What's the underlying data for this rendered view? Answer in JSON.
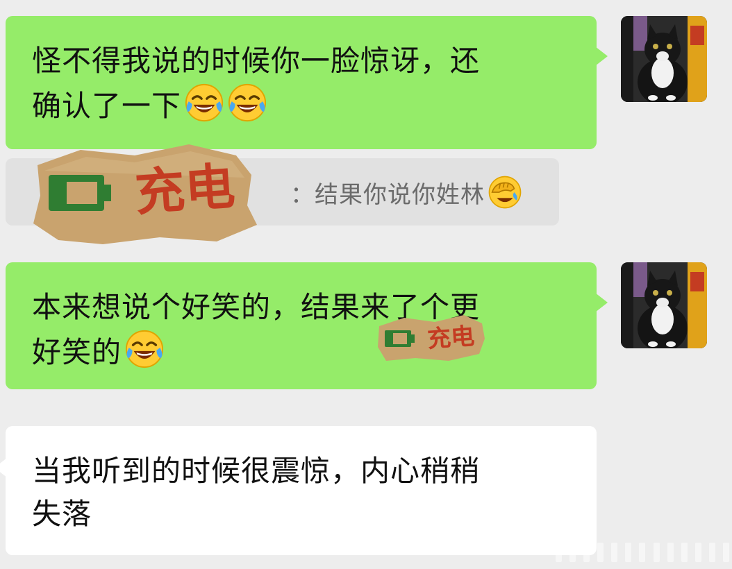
{
  "messages": [
    {
      "direction": "outgoing",
      "text_line1": "怪不得我说的时候你一脸惊讶，还",
      "text_line2": "确认了一下",
      "emojis": [
        "tears-of-joy-emoji",
        "tears-of-joy-emoji"
      ]
    },
    {
      "direction": "outgoing-quote",
      "quote_text": "：结果你说你姓林",
      "emoji": "facepalm-emoji"
    },
    {
      "direction": "outgoing",
      "text_line1": "本来想说个好笑的，结果来了个更",
      "text_line2": "好笑的",
      "emojis": [
        "tears-of-joy-emoji"
      ]
    },
    {
      "direction": "incoming",
      "text_line1": "当我听到的时候很震惊，内心稍稍",
      "text_line2": "失落"
    }
  ],
  "stickers": {
    "large": "充电",
    "small": "充电"
  },
  "colors": {
    "background": "#ededed",
    "outgoing_bubble": "#95ec69",
    "incoming_bubble": "#ffffff",
    "quote_bubble": "#e1e1e1",
    "sticker_paper": "#c9a36e",
    "sticker_text": "#c43c22",
    "battery_green": "#2f7d32"
  }
}
